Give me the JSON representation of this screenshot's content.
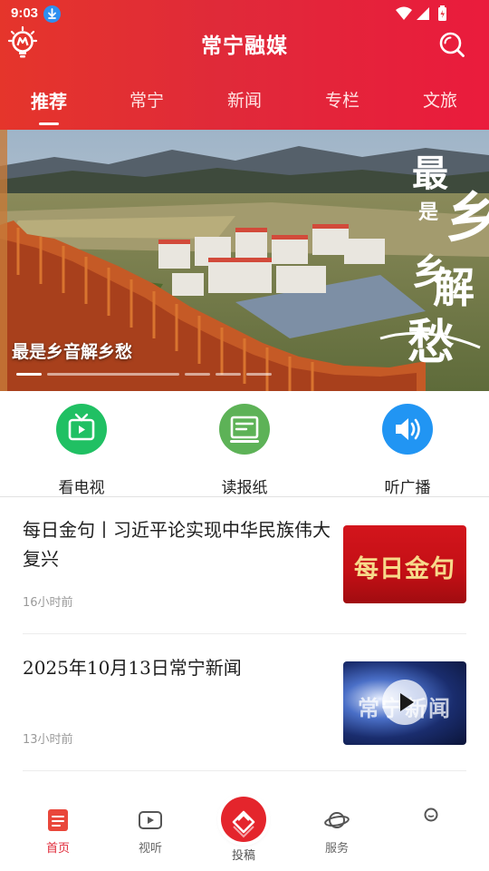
{
  "status_bar": {
    "time": "9:03"
  },
  "header": {
    "app_title": "常宁融媒"
  },
  "tabs": [
    {
      "label": "推荐",
      "active": true
    },
    {
      "label": "常宁",
      "active": false
    },
    {
      "label": "新闻",
      "active": false
    },
    {
      "label": "专栏",
      "active": false
    },
    {
      "label": "文旅",
      "active": false
    }
  ],
  "banner": {
    "caption": "最是乡音解乡愁",
    "overlay_calligraphy": "最是乡音解乡愁",
    "slide_count": 5,
    "active_slide": 1
  },
  "quick_entries": [
    {
      "label": "看电视",
      "icon": "tv-icon",
      "color": "#20c063"
    },
    {
      "label": "读报纸",
      "icon": "newspaper-icon",
      "color": "#5db257"
    },
    {
      "label": "听广播",
      "icon": "speaker-icon",
      "color": "#2195f3"
    }
  ],
  "news": [
    {
      "title": "每日金句丨习近平论实现中华民族伟大复兴",
      "time": "16小时前",
      "thumb_text": "每日金句",
      "thumb_type": "red"
    },
    {
      "title": "2025年10月13日常宁新闻",
      "time": "13小时前",
      "thumb_text": "常宁新闻",
      "thumb_type": "video"
    }
  ],
  "bottom_nav": [
    {
      "label": "首页",
      "icon": "home-icon",
      "active": true
    },
    {
      "label": "视听",
      "icon": "video-icon",
      "active": false
    },
    {
      "label": "投稿",
      "icon": "submit-icon",
      "active": false,
      "center": true
    },
    {
      "label": "服务",
      "icon": "planet-icon",
      "active": false
    },
    {
      "label": "",
      "icon": "user-icon",
      "active": false
    }
  ],
  "colors": {
    "brand_red": "#e02a39",
    "header_start": "#e5352b",
    "header_end": "#ea1b3c"
  }
}
